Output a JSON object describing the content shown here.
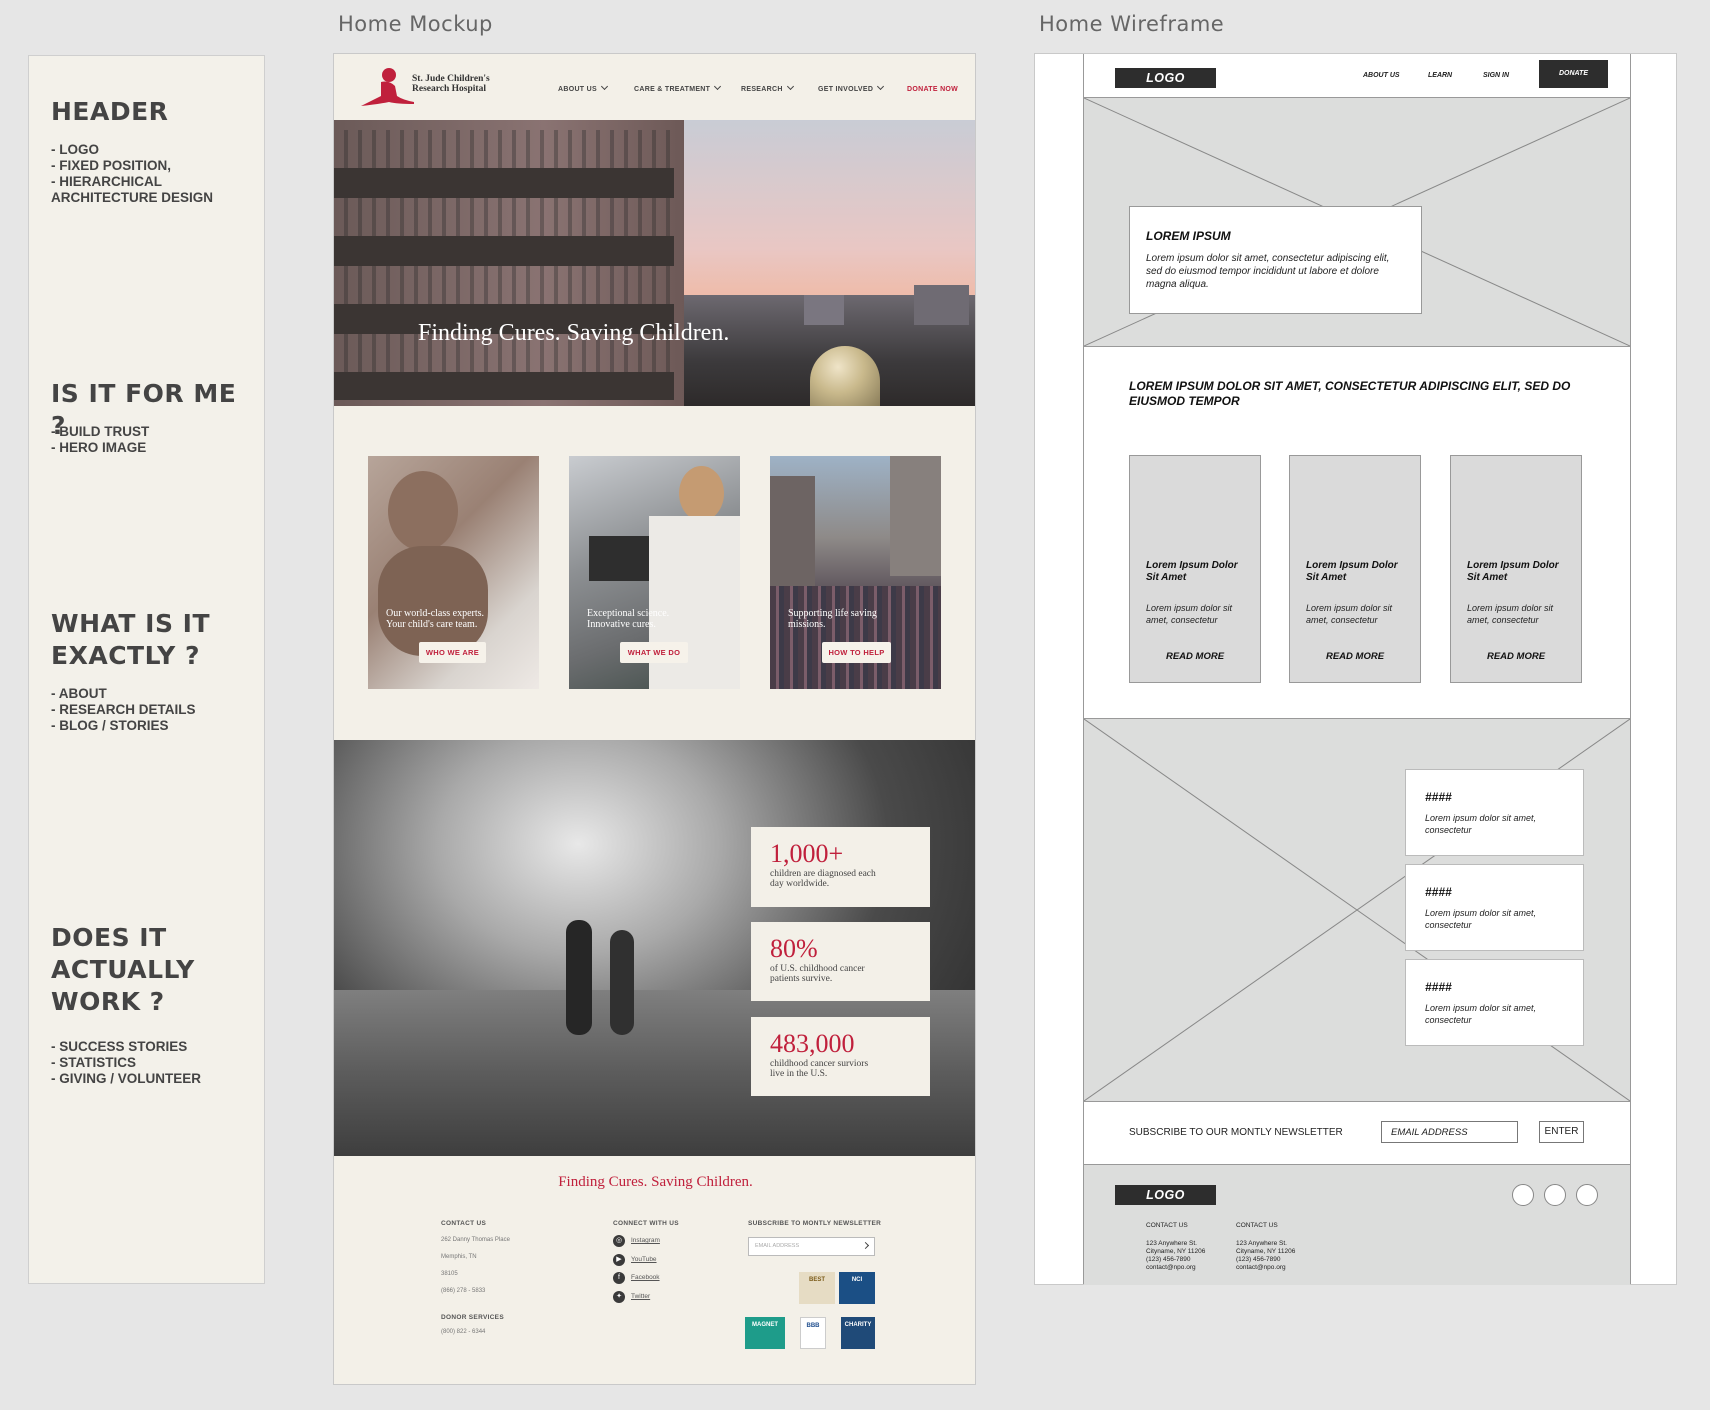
{
  "notes": {
    "sections": [
      {
        "heading": "HEADER",
        "items": [
          "- LOGO",
          "- FIXED POSITION,",
          "- HIERARCHICAL",
          "ARCHITECTURE DESIGN"
        ]
      },
      {
        "heading": "IS IT FOR ME ?",
        "items": [
          "- BUILD TRUST",
          "- HERO IMAGE"
        ]
      },
      {
        "heading": "WHAT IS IT EXACTLY ?",
        "items": [
          "- ABOUT",
          "- RESEARCH DETAILS",
          "- BLOG / STORIES"
        ]
      },
      {
        "heading": "DOES IT ACTUALLY WORK ?",
        "items": [
          "- SUCCESS STORIES",
          "- STATISTICS",
          "- GIVING / VOLUNTEER"
        ]
      }
    ]
  },
  "mockup": {
    "title": "Home Mockup",
    "logo": {
      "line1": "St. Jude Children's",
      "line2": "Research Hospital"
    },
    "nav": [
      "ABOUT US",
      "CARE & TREATMENT",
      "RESEARCH",
      "GET INVOLVED"
    ],
    "donate": "DONATE NOW",
    "hero_text": "Finding Cures. Saving Children.",
    "cards": [
      {
        "caption_1": "Our world-class experts.",
        "caption_2": "Your child's care team.",
        "button": "WHO WE ARE"
      },
      {
        "caption_1": "Exceptional science.",
        "caption_2": "Innovative cures.",
        "button": "WHAT WE DO"
      },
      {
        "caption_1": "Supporting life saving",
        "caption_2": "missions.",
        "button": "HOW TO HELP"
      }
    ],
    "stats": [
      {
        "number": "1,000+",
        "line1": "children are diagnosed each",
        "line2": "day worldwide."
      },
      {
        "number": "80%",
        "line1": "of U.S. childhood cancer",
        "line2": "patients survive."
      },
      {
        "number": "483,000",
        "line1": "childhood cancer surviors",
        "line2": "live in the U.S."
      }
    ],
    "footer": {
      "tagline": "Finding Cures. Saving Children.",
      "contact_heading": "CONTACT US",
      "address1": "262 Danny Thomas Place",
      "address2": "Memphis, TN",
      "zip": "38105",
      "phone": "(866) 278 - 5833",
      "donor_heading": "DONOR SERVICES",
      "donor_phone": "(800) 822 - 6344",
      "connect_heading": "CONNECT WITH US",
      "social": [
        "Instagram",
        "YouTube",
        "Facebook",
        "Twitter"
      ],
      "newsletter_heading": "SUBSCRIBE TO MONTLY NEWSLETTER",
      "email_placeholder": "EMAIL ADDRESS",
      "badges": [
        "BEST",
        "NCI",
        "MAGNET",
        "BBB",
        "CHARITY"
      ]
    }
  },
  "wireframe": {
    "title": "Home Wireframe",
    "logo": "LOGO",
    "nav": [
      "ABOUT US",
      "LEARN",
      "SIGN IN"
    ],
    "donate": "DONATE",
    "hero_box": {
      "title": "LOREM IPSUM",
      "text": "Lorem ipsum dolor sit amet, consectetur adipiscing elit, sed do eiusmod tempor incididunt ut labore et dolore magna aliqua."
    },
    "intro": "LOREM IPSUM DOLOR SIT AMET, CONSECTETUR ADIPISCING ELIT, SED DO EIUSMOD TEMPOR",
    "cards": [
      {
        "title": "Lorem Ipsum Dolor Sit Amet",
        "text": "Lorem ipsum dolor sit amet, consectetur",
        "link": "READ MORE"
      },
      {
        "title": "Lorem Ipsum Dolor Sit Amet",
        "text": "Lorem ipsum dolor sit amet, consectetur",
        "link": "READ MORE"
      },
      {
        "title": "Lorem Ipsum Dolor Sit Amet",
        "text": "Lorem ipsum dolor sit amet, consectetur",
        "link": "READ MORE"
      }
    ],
    "stats": [
      {
        "number": "####",
        "text": "Lorem ipsum dolor sit amet, consectetur"
      },
      {
        "number": "####",
        "text": "Lorem ipsum dolor sit amet, consectetur"
      },
      {
        "number": "####",
        "text": "Lorem ipsum dolor sit amet, consectetur"
      }
    ],
    "newsletter": {
      "label": "SUBSCRIBE TO OUR MONTLY NEWSLETTER",
      "placeholder": "EMAIL ADDRESS",
      "button": "ENTER"
    },
    "footer": {
      "logo": "LOGO",
      "cols": [
        {
          "heading": "CONTACT US",
          "body": "123 Anywhere St.\nCityname, NY 11206\n(123) 456-7890\ncontact@npo.org"
        },
        {
          "heading": "CONTACT US",
          "body": "123 Anywhere St.\nCityname, NY 11206\n(123) 456-7890\ncontact@npo.org"
        }
      ]
    }
  },
  "colors": {
    "brand_red": "#c0203c",
    "panel": "#f3f0e8",
    "wire_gray": "#dcdcdc"
  }
}
